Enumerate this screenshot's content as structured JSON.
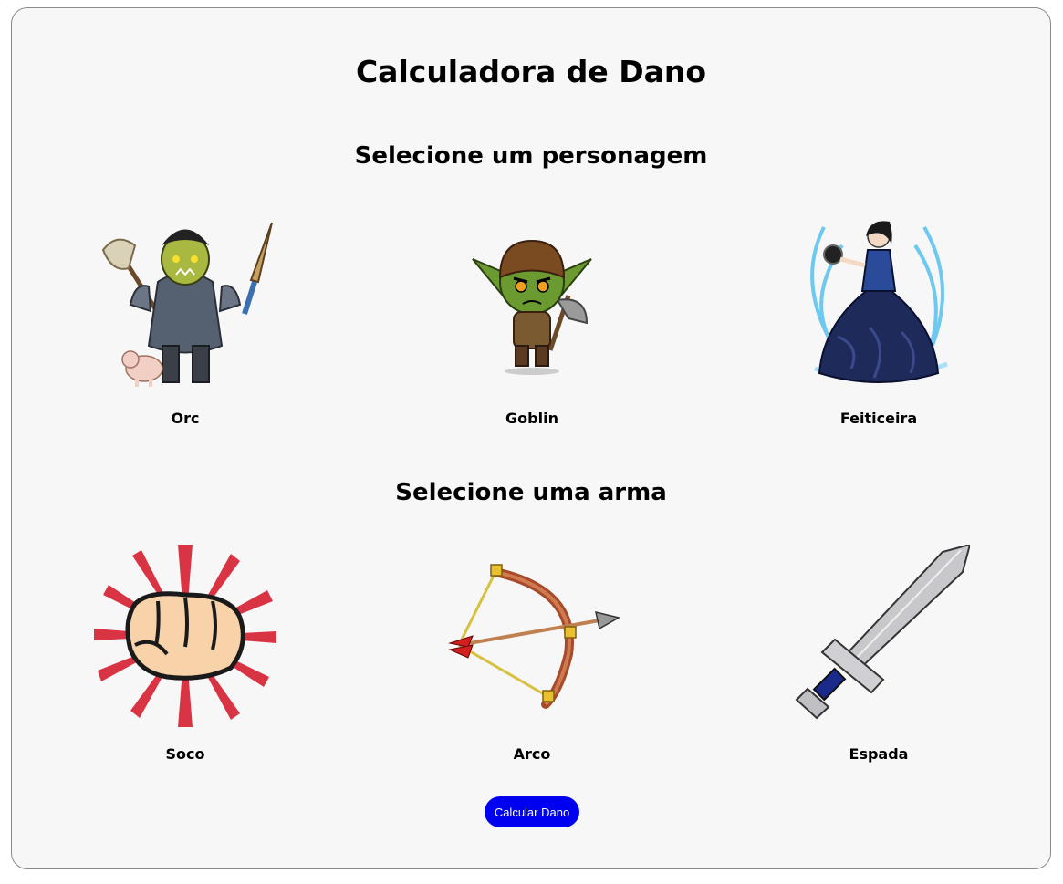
{
  "title": "Calculadora de Dano",
  "characters_section": {
    "heading": "Selecione um personagem",
    "items": [
      {
        "label": "Orc",
        "icon": "orc-icon"
      },
      {
        "label": "Goblin",
        "icon": "goblin-icon"
      },
      {
        "label": "Feiticeira",
        "icon": "sorceress-icon"
      }
    ]
  },
  "weapons_section": {
    "heading": "Selecione uma arma",
    "items": [
      {
        "label": "Soco",
        "icon": "fist-icon"
      },
      {
        "label": "Arco",
        "icon": "bow-icon"
      },
      {
        "label": "Espada",
        "icon": "sword-icon"
      }
    ]
  },
  "button": {
    "label": "Calcular Dano",
    "color": "#0000f0"
  }
}
